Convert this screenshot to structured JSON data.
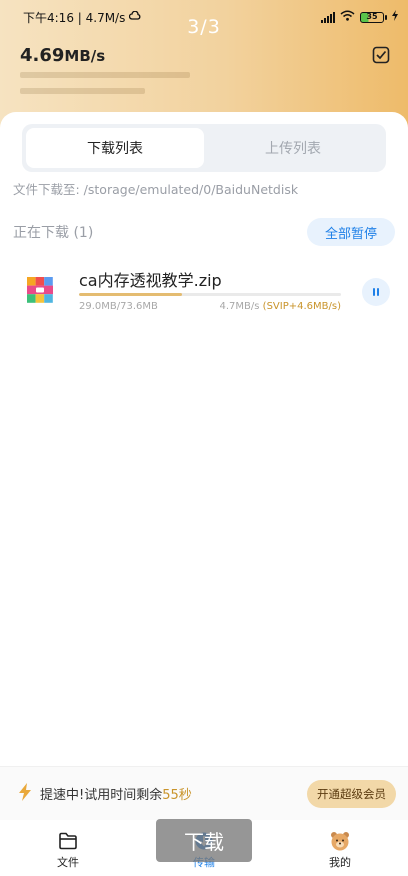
{
  "statusbar": {
    "time_text": "下午4:16 | 4.7M/s",
    "battery": "35",
    "icons": [
      "cloud-icon",
      "signal-icon",
      "wifi-icon",
      "battery-icon",
      "charging-icon"
    ]
  },
  "page_indicator": "3/3",
  "header": {
    "speed_value": "4.69",
    "speed_unit": "MB/s"
  },
  "tabs": [
    {
      "label": "下载列表",
      "active": true
    },
    {
      "label": "上传列表",
      "active": false
    }
  ],
  "download_path": "文件下载至: /storage/emulated/0/BaiduNetdisk",
  "downloading": {
    "title": "正在下载 (1)",
    "pause_all_label": "全部暂停"
  },
  "tasks": [
    {
      "filename": "ca内存透视教学.zip",
      "size": "29.0MB/73.6MB",
      "progress": 0.394,
      "rate": "4.7MB/s",
      "svip_rate": "(SVIP+4.6MB/s)"
    }
  ],
  "promo": {
    "text": "提速中!试用时间剩余",
    "seconds": "55秒",
    "vip_button": "开通超级会员"
  },
  "nav": [
    {
      "label": "文件",
      "icon": "folder-icon"
    },
    {
      "label": "传输",
      "icon": "transfer-icon"
    },
    {
      "label": "我的",
      "icon": "bear-avatar-icon"
    }
  ],
  "toast": "下载",
  "colors": {
    "accent": "#1e80e8",
    "progress": "#e4bc71",
    "svip": "#c9942b"
  }
}
